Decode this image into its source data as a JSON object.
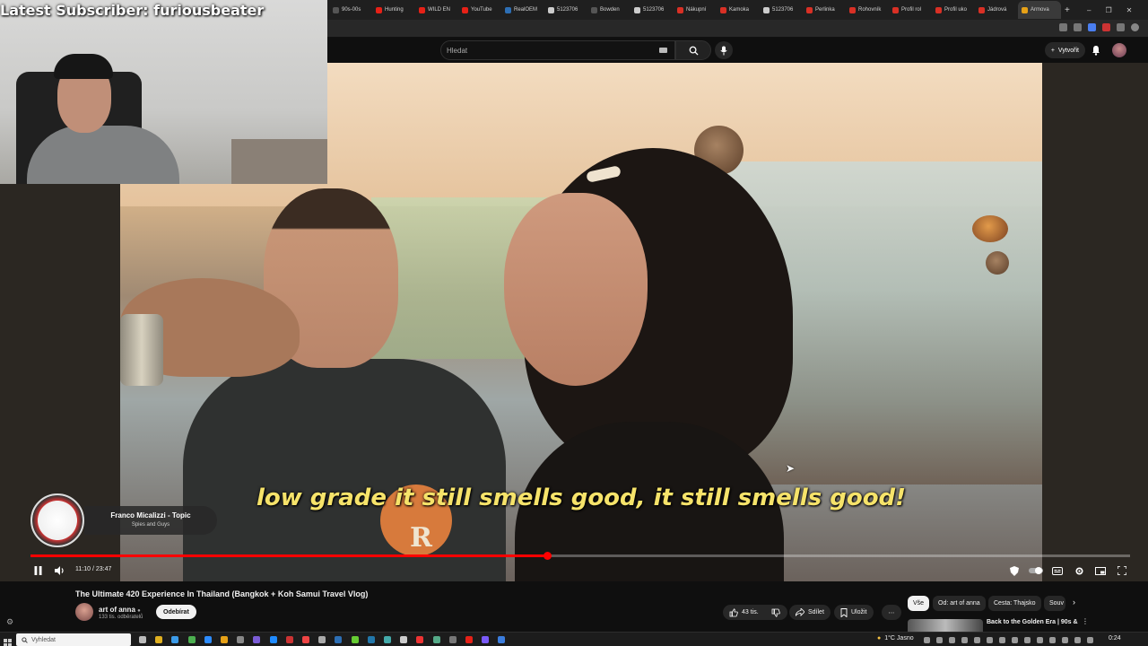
{
  "overlay": {
    "subscriber_text": "Latest Subscriber: furiousbeater"
  },
  "browser": {
    "tabs": [
      {
        "label": "90s-00s",
        "color": "#555555"
      },
      {
        "label": "Hunting",
        "color": "#e62117"
      },
      {
        "label": "WILD EN",
        "color": "#e62117"
      },
      {
        "label": "YouTube",
        "color": "#e62117"
      },
      {
        "label": "RealOEM",
        "color": "#2d6fb5"
      },
      {
        "label": "5123706",
        "color": "#cccccc"
      },
      {
        "label": "Bowden",
        "color": "#555555"
      },
      {
        "label": "5123706",
        "color": "#cccccc"
      },
      {
        "label": "Nákupní",
        "color": "#d93025"
      },
      {
        "label": "Kamoka",
        "color": "#d93025"
      },
      {
        "label": "5123706",
        "color": "#cccccc"
      },
      {
        "label": "Perlinka",
        "color": "#d93025"
      },
      {
        "label": "Rohovník",
        "color": "#d93025"
      },
      {
        "label": "Profil rol",
        "color": "#d93025"
      },
      {
        "label": "Profil uko",
        "color": "#d93025"
      },
      {
        "label": "Jádrová",
        "color": "#d93025"
      },
      {
        "label": "Armova",
        "color": "#e6a117"
      }
    ],
    "active_tab_index": 16,
    "new_tab": "+"
  },
  "youtube": {
    "search_placeholder": "Hledat",
    "create_label": "Vytvořit",
    "player": {
      "subtitle": "low grade it still smells good, it still smells good!",
      "timecode": "11:10 / 23:47",
      "progress_fraction": 0.47,
      "now_playing": {
        "title": "Franco Micalizzi - Topic",
        "subtitle": "Spies and Guys"
      }
    },
    "video": {
      "title": "The Ultimate 420 Experience In Thailand (Bangkok + Koh Samui Travel Vlog)",
      "channel": "art of anna",
      "subscribers": "133 tis. odběratelů",
      "subscribe_label": "Odebírat",
      "likes": "43 tis.",
      "share_label": "Sdílet",
      "save_label": "Uložit",
      "more_label": "⋯"
    },
    "chips": [
      "Vše",
      "Od: art of anna",
      "Cesta: Thajsko",
      "Souv"
    ],
    "recommendation": {
      "title": "Back to the Golden Era | 90s &"
    }
  },
  "taskbar": {
    "search_placeholder": "Vyhledat",
    "weather": "1°C  Jasno",
    "clock": "0:24"
  }
}
